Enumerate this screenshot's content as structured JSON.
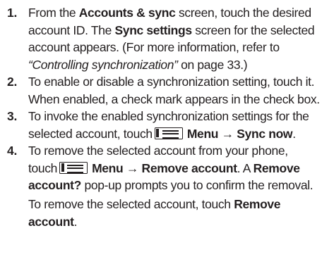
{
  "steps": [
    {
      "number": "1.",
      "lines": [
        {
          "p1": "From the ",
          "b1": "Accounts & sync",
          "p2": " screen, touch the desired"
        },
        {
          "p1": "account ID. The ",
          "b1": "Sync settings",
          "p2": " screen for the selected"
        },
        {
          "p1": "account appears. (For more information, refer to"
        },
        {
          "i1": "“Controlling synchronization”",
          "p1": " on page 33.)"
        }
      ]
    },
    {
      "number": "2.",
      "lines": [
        {
          "p1": "To enable or disable a synchronization setting, touch it."
        },
        {
          "p1": "When enabled, a check mark appears in the check box."
        }
      ]
    },
    {
      "number": "3.",
      "lines": [
        {
          "p1": "To invoke the enabled synchronization settings for the"
        },
        {
          "p1": "selected account, touch",
          "b1": "Menu → Sync now",
          "p2": "."
        }
      ]
    },
    {
      "number": "4.",
      "lines": [
        {
          "p1": "To remove the selected account from your phone,"
        },
        {
          "p1": "touch",
          "b1": "Menu → Remove account",
          "p2": ". A ",
          "b2": "Remove"
        },
        {
          "b1": "account?",
          "p1": " pop-up prompts you to confirm the removal."
        },
        {
          "p1": "To remove the selected account, touch ",
          "b1": "Remove"
        },
        {
          "b1": "account",
          "p1": "."
        }
      ]
    }
  ],
  "icons": [
    "menu-icon"
  ]
}
